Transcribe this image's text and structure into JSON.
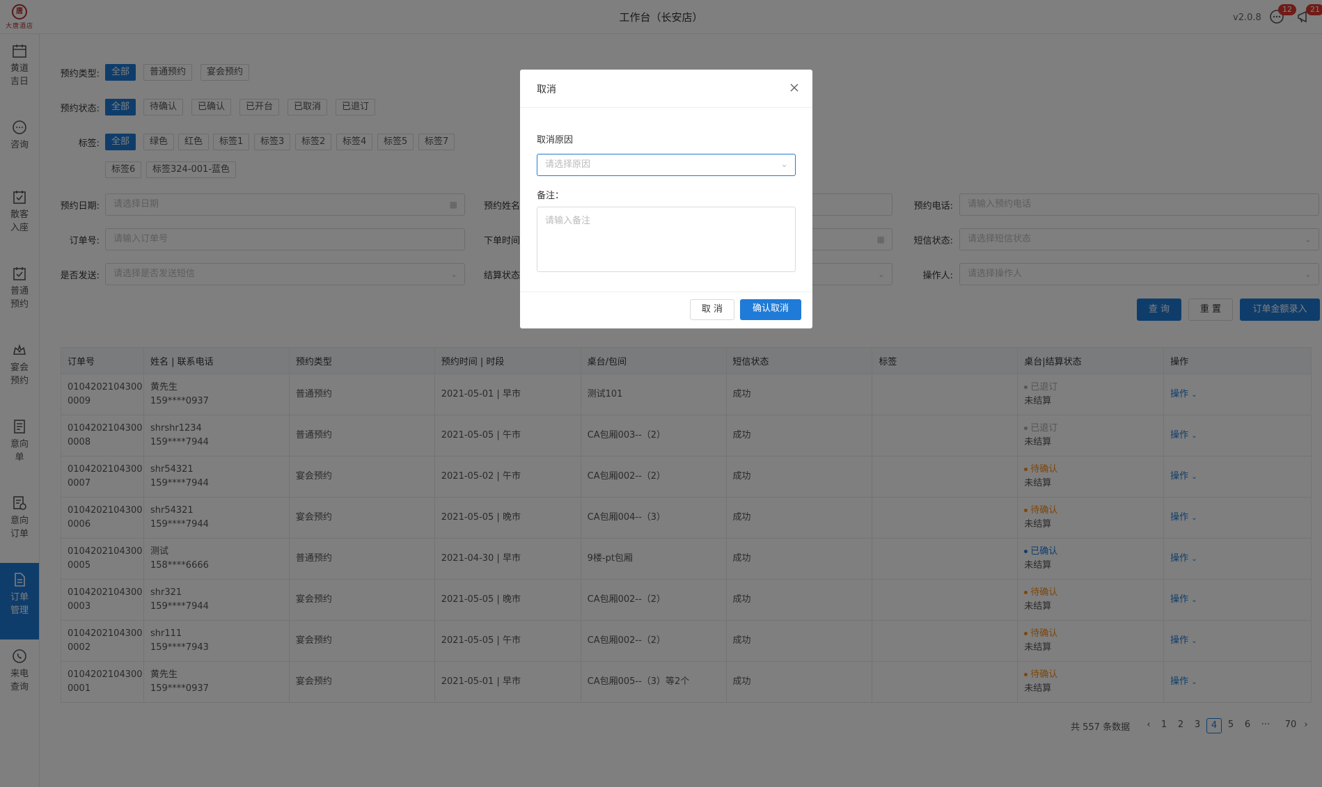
{
  "header": {
    "logo_text": "大唐酒店",
    "title": "工作台（长安店）",
    "version": "v2.0.8",
    "chat_badge": "12",
    "notice_badge": "21"
  },
  "sidebar": {
    "items": [
      {
        "label": "黄道吉日",
        "icon": "calendar-icon"
      },
      {
        "label": "咨询",
        "icon": "chat-icon"
      },
      {
        "label": "散客入座",
        "icon": "checkin-icon"
      },
      {
        "label": "普通预约",
        "icon": "reserve-icon"
      },
      {
        "label": "宴会预约",
        "icon": "banquet-icon"
      },
      {
        "label": "意向单",
        "icon": "intent-icon"
      },
      {
        "label": "意向订单",
        "icon": "intent-order-icon"
      },
      {
        "label": "订单管理",
        "icon": "order-icon"
      },
      {
        "label": "来电查询",
        "icon": "phone-icon"
      }
    ]
  },
  "filters": {
    "type_label": "预约类型:",
    "types": [
      "全部",
      "普通预约",
      "宴会预约"
    ],
    "status_label": "预约状态:",
    "statuses": [
      "全部",
      "待确认",
      "已确认",
      "已开台",
      "已取消",
      "已退订"
    ],
    "tag_label": "标签:",
    "tags": [
      "全部",
      "绿色",
      "红色",
      "标签1",
      "标签3",
      "标签2",
      "标签4",
      "标签5",
      "标签7",
      "标签6",
      "标签324-001-蓝色"
    ],
    "date_label": "预约日期:",
    "date_placeholder": "请选择日期",
    "name_label": "预约姓名",
    "phone_label": "预约电话:",
    "phone_placeholder": "请输入预约电话",
    "order_label": "订单号:",
    "order_placeholder": "请输入订单号",
    "ordertime_label": "下单时间",
    "sms_label": "短信状态:",
    "sms_placeholder": "请选择短信状态",
    "send_label": "是否发送:",
    "send_placeholder": "请选择是否发送短信",
    "settle_label": "结算状态",
    "operator_label": "操作人:",
    "operator_placeholder": "请选择操作人"
  },
  "actions": {
    "query": "查 询",
    "reset": "重 置",
    "enter_amount": "订单金额录入"
  },
  "table": {
    "headers": [
      "订单号",
      "姓名 | 联系电话",
      "预约类型",
      "预约时间 | 时段",
      "桌台/包间",
      "短信状态",
      "标签",
      "桌台|结算状态",
      "操作"
    ],
    "rows": [
      {
        "order1": "0104202104300",
        "order2": "0009",
        "name": "黄先生",
        "phone": "159****0937",
        "type": "普通预约",
        "time": "2021-05-01 | 早市",
        "table": "测试101",
        "sms": "成功",
        "tag": "",
        "status": "已退订",
        "status_class": "st-gray",
        "settle": "未结算",
        "op": "操作"
      },
      {
        "order1": "0104202104300",
        "order2": "0008",
        "name": "shrshr1234",
        "phone": "159****7944",
        "type": "普通预约",
        "time": "2021-05-05 | 午市",
        "table": "CA包厢003--（2）",
        "sms": "成功",
        "tag": "",
        "status": "已退订",
        "status_class": "st-gray",
        "settle": "未结算",
        "op": "操作"
      },
      {
        "order1": "0104202104300",
        "order2": "0007",
        "name": "shr54321",
        "phone": "159****7944",
        "type": "宴会预约",
        "time": "2021-05-02 | 午市",
        "table": "CA包厢002--（2）",
        "sms": "成功",
        "tag": "",
        "status": "待确认",
        "status_class": "st-orange",
        "settle": "未结算",
        "op": "操作"
      },
      {
        "order1": "0104202104300",
        "order2": "0006",
        "name": "shr54321",
        "phone": "159****7944",
        "type": "宴会预约",
        "time": "2021-05-05 | 晚市",
        "table": "CA包厢004--（3）",
        "sms": "成功",
        "tag": "",
        "status": "待确认",
        "status_class": "st-orange",
        "settle": "未结算",
        "op": "操作"
      },
      {
        "order1": "0104202104300",
        "order2": "0005",
        "name": "测试",
        "phone": "158****6666",
        "type": "普通预约",
        "time": "2021-04-30 | 早市",
        "table": "9楼-pt包厢",
        "sms": "成功",
        "tag": "",
        "status": "已确认",
        "status_class": "st-blue",
        "settle": "未结算",
        "op": "操作"
      },
      {
        "order1": "0104202104300",
        "order2": "0003",
        "name": "shr321",
        "phone": "159****7944",
        "type": "宴会预约",
        "time": "2021-05-05 | 晚市",
        "table": "CA包厢002--（2）",
        "sms": "成功",
        "tag": "",
        "status": "待确认",
        "status_class": "st-orange",
        "settle": "未结算",
        "op": "操作"
      },
      {
        "order1": "0104202104300",
        "order2": "0002",
        "name": "shr111",
        "phone": "159****7943",
        "type": "宴会预约",
        "time": "2021-05-05 | 午市",
        "table": "CA包厢002--（2）",
        "sms": "成功",
        "tag": "",
        "status": "待确认",
        "status_class": "st-orange",
        "settle": "未结算",
        "op": "操作"
      },
      {
        "order1": "0104202104300",
        "order2": "0001",
        "name": "黄先生",
        "phone": "159****0937",
        "type": "宴会预约",
        "time": "2021-05-01 | 早市",
        "table": "CA包厢005--（3）等2个",
        "sms": "成功",
        "tag": "",
        "status": "待确认",
        "status_class": "st-orange",
        "settle": "未结算",
        "op": "操作"
      }
    ]
  },
  "pagination": {
    "total": "共 557 条数据",
    "pages": [
      "1",
      "2",
      "3",
      "4",
      "5",
      "6",
      "···",
      "70"
    ],
    "current": "4"
  },
  "modal": {
    "title": "取消",
    "reason_label": "取消原因",
    "reason_placeholder": "请选择原因",
    "remark_label": "备注：",
    "remark_placeholder": "请输入备注",
    "cancel": "取 消",
    "confirm": "确认取消"
  },
  "colors": {
    "primary": "#1f7bd7",
    "success": "#52c41a",
    "warning": "#fa8c16",
    "badge": "#e0362f"
  }
}
